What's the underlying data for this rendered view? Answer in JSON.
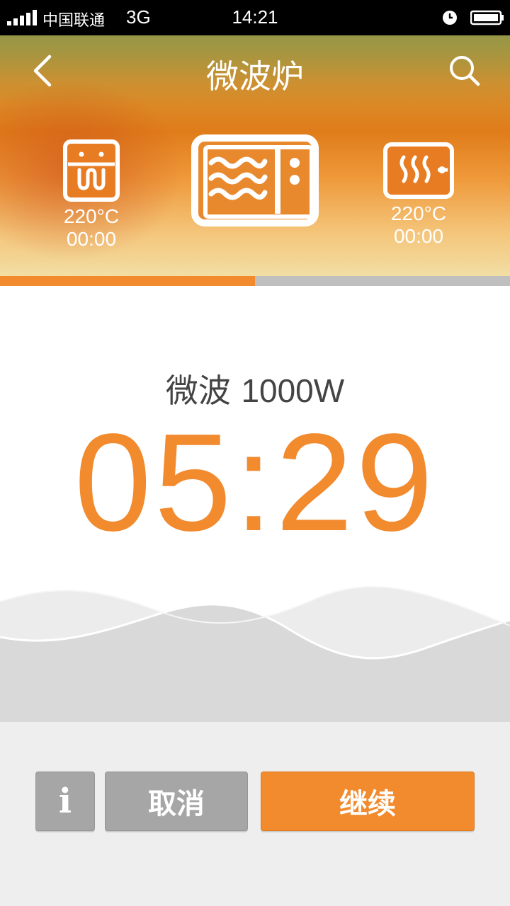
{
  "status_bar": {
    "carrier": "中国联通",
    "network": "3G",
    "time": "14:21"
  },
  "header": {
    "title": "微波炉",
    "back_icon": "chevron-left-icon",
    "search_icon": "search-icon"
  },
  "modes": [
    {
      "name": "oven-mode",
      "icon": "oven-icon",
      "temp": "220°C",
      "time": "00:00"
    },
    {
      "name": "microwave-mode",
      "icon": "microwave-icon",
      "selected": true
    },
    {
      "name": "steam-mode",
      "icon": "steam-icon",
      "temp": "220°C",
      "time": "00:00"
    }
  ],
  "progress": {
    "fraction": 0.5,
    "fill_color": "#f28a2e",
    "track_color": "#bfbfbf"
  },
  "main": {
    "mode_label": "微波",
    "power": "1000W",
    "timer": "05:29",
    "accent_color": "#f28a2e"
  },
  "buttons": {
    "info": "i",
    "cancel": "取消",
    "continue": "继续"
  }
}
